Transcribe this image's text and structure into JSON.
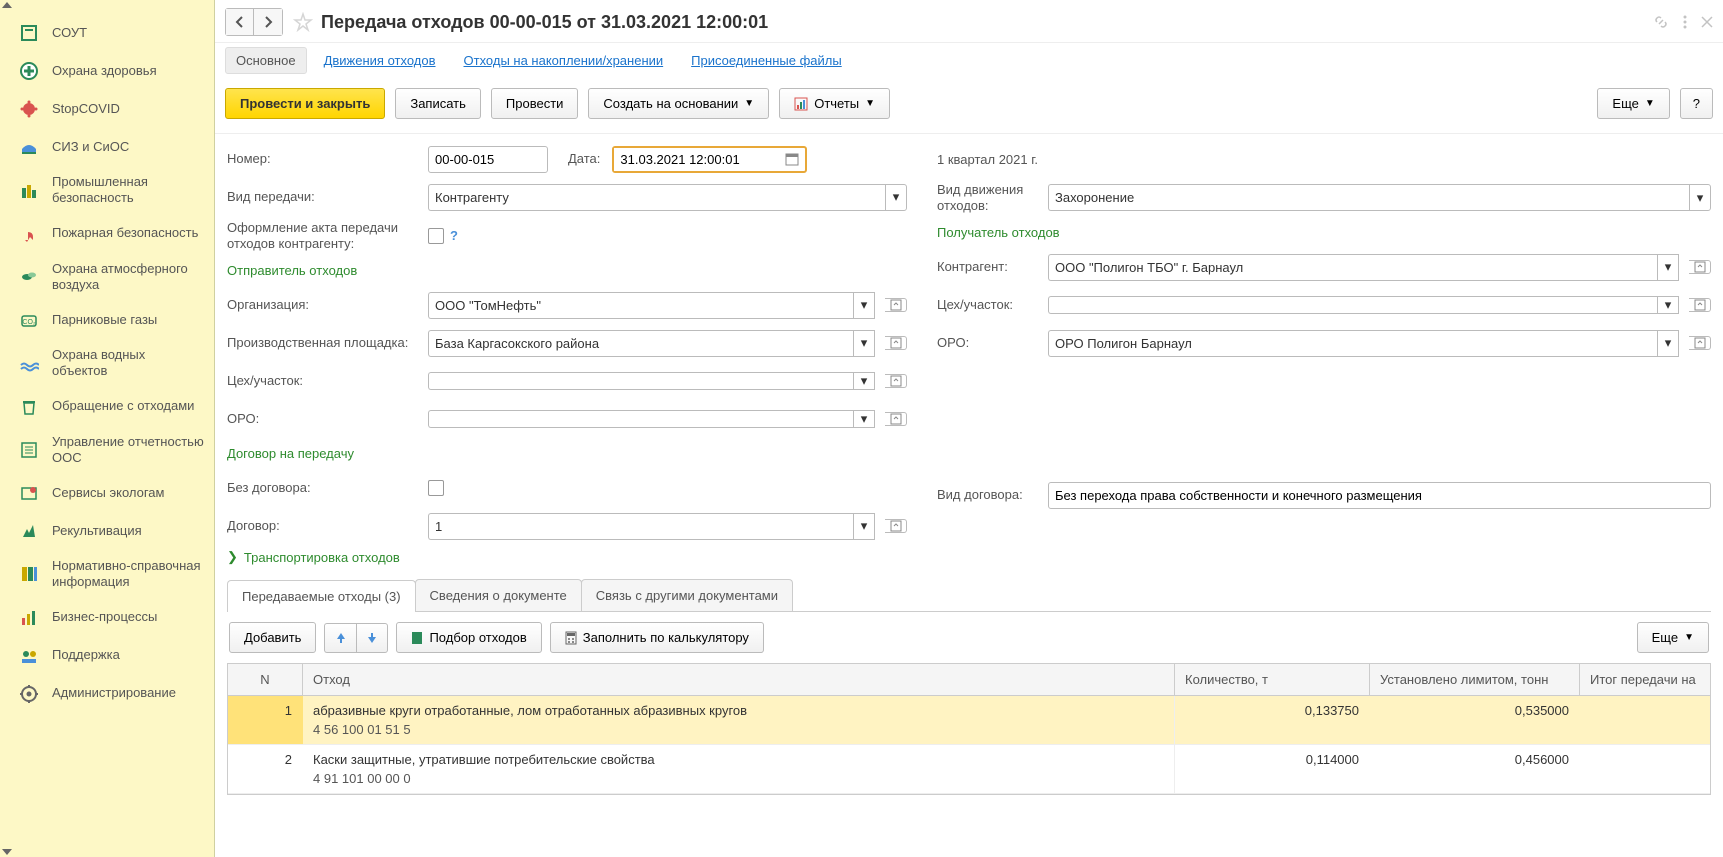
{
  "sidebar": {
    "items": [
      {
        "label": "СОУТ"
      },
      {
        "label": "Охрана здоровья"
      },
      {
        "label": "StopCOVID"
      },
      {
        "label": "СИЗ и СиОС"
      },
      {
        "label": "Промышленная безопасность"
      },
      {
        "label": "Пожарная безопасность"
      },
      {
        "label": "Охрана атмосферного воздуха"
      },
      {
        "label": "Парниковые газы"
      },
      {
        "label": "Охрана водных объектов"
      },
      {
        "label": "Обращение с отходами"
      },
      {
        "label": "Управление отчетностью ООС"
      },
      {
        "label": "Сервисы экологам"
      },
      {
        "label": "Рекультивация"
      },
      {
        "label": "Нормативно-справочная информация"
      },
      {
        "label": "Бизнес-процессы"
      },
      {
        "label": "Поддержка"
      },
      {
        "label": "Администрирование"
      }
    ]
  },
  "header": {
    "title": "Передача отходов 00-00-015 от 31.03.2021 12:00:01"
  },
  "subtabs": {
    "main": "Основное",
    "movements": "Движения отходов",
    "storage": "Отходы на накоплении/хранении",
    "attached": "Присоединенные файлы"
  },
  "toolbar": {
    "post_close": "Провести и закрыть",
    "save": "Записать",
    "post": "Провести",
    "create_based": "Создать на основании",
    "reports": "Отчеты",
    "more": "Еще",
    "help": "?"
  },
  "form": {
    "number_label": "Номер:",
    "number": "00-00-015",
    "date_label": "Дата:",
    "date": "31.03.2021 12:00:01",
    "quarter": "1 квартал 2021 г.",
    "transfer_type_label": "Вид передачи:",
    "transfer_type": "Контрагенту",
    "movement_type_label": "Вид движения отходов:",
    "movement_type": "Захоронение",
    "act_label": "Оформление акта передачи отходов контрагенту:",
    "sender_section": "Отправитель отходов",
    "org_label": "Организация:",
    "org": "ООО \"ТомНефть\"",
    "site_label": "Производственная площадка:",
    "site": "База Каргасокского района",
    "dept_label": "Цех/участок:",
    "dept": "",
    "oro_label": "ОРО:",
    "oro": "",
    "receiver_section": "Получатель отходов",
    "counterparty_label": "Контрагент:",
    "counterparty": "ООО \"Полигон ТБО\" г. Барнаул",
    "rec_dept_label": "Цех/участок:",
    "rec_dept": "",
    "rec_oro_label": "ОРО:",
    "rec_oro": "ОРО Полигон Барнаул",
    "contract_section": "Договор на передачу",
    "no_contract_label": "Без договора:",
    "contract_label": "Договор:",
    "contract": "1",
    "contract_type_label": "Вид договора:",
    "contract_type": "Без перехода права собственности и конечного размещения",
    "transport_section": "Транспортировка отходов"
  },
  "inner_tabs": {
    "wastes": "Передаваемые отходы (3)",
    "docinfo": "Сведения о документе",
    "links": "Связь с другими документами"
  },
  "tab_toolbar": {
    "add": "Добавить",
    "pick": "Подбор отходов",
    "calc": "Заполнить по калькулятору",
    "more": "Еще"
  },
  "table": {
    "headers": {
      "n": "N",
      "waste": "Отход",
      "qty": "Количество, т",
      "limit": "Установлено лимитом, тонн",
      "total": "Итог передачи на"
    },
    "rows": [
      {
        "n": "1",
        "name": "абразивные круги отработанные, лом отработанных абразивных кругов",
        "code": "4 56 100 01 51 5",
        "qty": "0,133750",
        "limit": "0,535000",
        "total": ""
      },
      {
        "n": "2",
        "name": "Каски защитные, утратившие потребительские свойства",
        "code": "4 91 101 00 00 0",
        "qty": "0,114000",
        "limit": "0,456000",
        "total": ""
      }
    ]
  }
}
